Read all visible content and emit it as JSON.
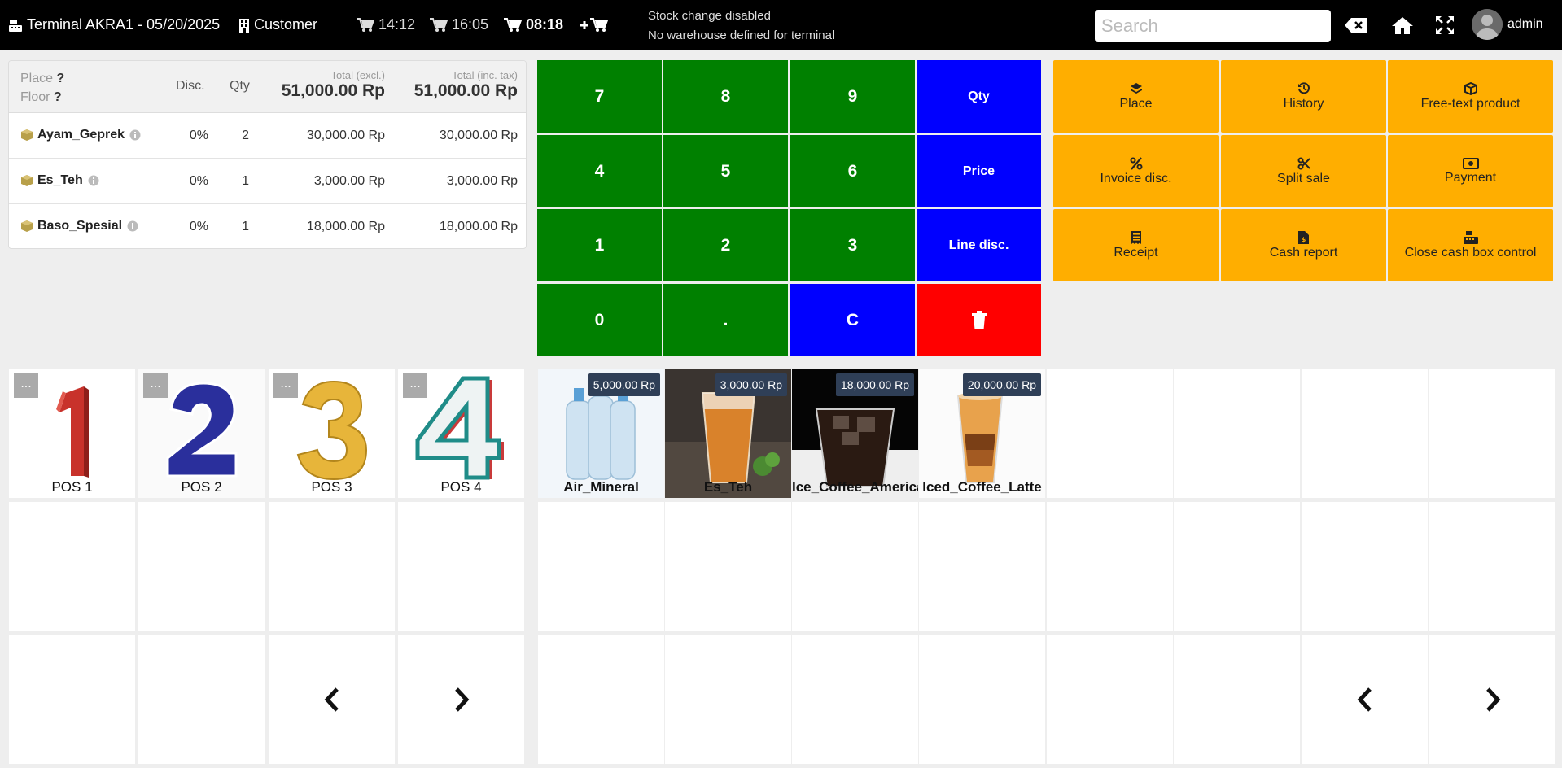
{
  "topbar": {
    "terminal": "Terminal AKRA1 - 05/20/2025",
    "customer": "Customer",
    "carts": [
      {
        "time": "14:12",
        "active": false
      },
      {
        "time": "16:05",
        "active": false
      },
      {
        "time": "08:18",
        "active": true
      }
    ],
    "notes": [
      "Stock change disabled",
      "No warehouse defined for terminal"
    ],
    "search_placeholder": "Search",
    "user": "admin"
  },
  "order": {
    "place_label": "Place",
    "place_value": "?",
    "floor_label": "Floor",
    "floor_value": "?",
    "col_disc": "Disc.",
    "col_qty": "Qty",
    "total_excl_label": "Total (excl.)",
    "total_excl": "51,000.00 Rp",
    "total_inc_label": "Total (inc. tax)",
    "total_inc": "51,000.00 Rp",
    "lines": [
      {
        "name": "Ayam_Geprek",
        "disc": "0%",
        "qty": "2",
        "excl": "30,000.00 Rp",
        "inc": "30,000.00 Rp"
      },
      {
        "name": "Es_Teh",
        "disc": "0%",
        "qty": "1",
        "excl": "3,000.00 Rp",
        "inc": "3,000.00 Rp"
      },
      {
        "name": "Baso_Spesial",
        "disc": "0%",
        "qty": "1",
        "excl": "18,000.00 Rp",
        "inc": "18,000.00 Rp"
      }
    ]
  },
  "keypad": {
    "k7": "7",
    "k8": "8",
    "k9": "9",
    "qty": "Qty",
    "k4": "4",
    "k5": "5",
    "k6": "6",
    "price": "Price",
    "k1": "1",
    "k2": "2",
    "k3": "3",
    "line_disc": "Line disc.",
    "k0": "0",
    "dot": ".",
    "clear": "C"
  },
  "actions": {
    "place": "Place",
    "history": "History",
    "free_text": "Free-text product",
    "invoice_disc": "Invoice disc.",
    "split_sale": "Split sale",
    "payment": "Payment",
    "receipt": "Receipt",
    "cash_report": "Cash report",
    "close_cash": "Close cash box control"
  },
  "categories": {
    "dots": "...",
    "items": [
      {
        "label": "POS 1"
      },
      {
        "label": "POS 2"
      },
      {
        "label": "POS 3"
      },
      {
        "label": "POS 4"
      }
    ]
  },
  "products": [
    {
      "name": "Air_Mineral",
      "price": "5,000.00 Rp"
    },
    {
      "name": "Es_Teh",
      "price": "3,000.00 Rp"
    },
    {
      "name": "Ice_Coffee_Americano",
      "price": "18,000.00 Rp"
    },
    {
      "name": "Iced_Coffee_Latte",
      "price": "20,000.00 Rp"
    }
  ],
  "colors": {
    "keypad_number": "#008000",
    "keypad_function": "#0000ff",
    "keypad_delete": "#ff0000",
    "action": "#ffae00",
    "price_badge": "#2f3f57"
  },
  "icons": [
    "cash-register-icon",
    "building-icon",
    "cart-icon",
    "add-cart-icon",
    "backspace-icon",
    "home-icon",
    "fullscreen-icon",
    "cube-icon",
    "info-icon",
    "trash-icon",
    "layers-icon",
    "history-icon",
    "percent-icon",
    "scissors-icon",
    "money-icon",
    "receipt-icon",
    "file-dollar-icon",
    "cash-box-icon",
    "chevron-left-icon",
    "chevron-right-icon"
  ]
}
